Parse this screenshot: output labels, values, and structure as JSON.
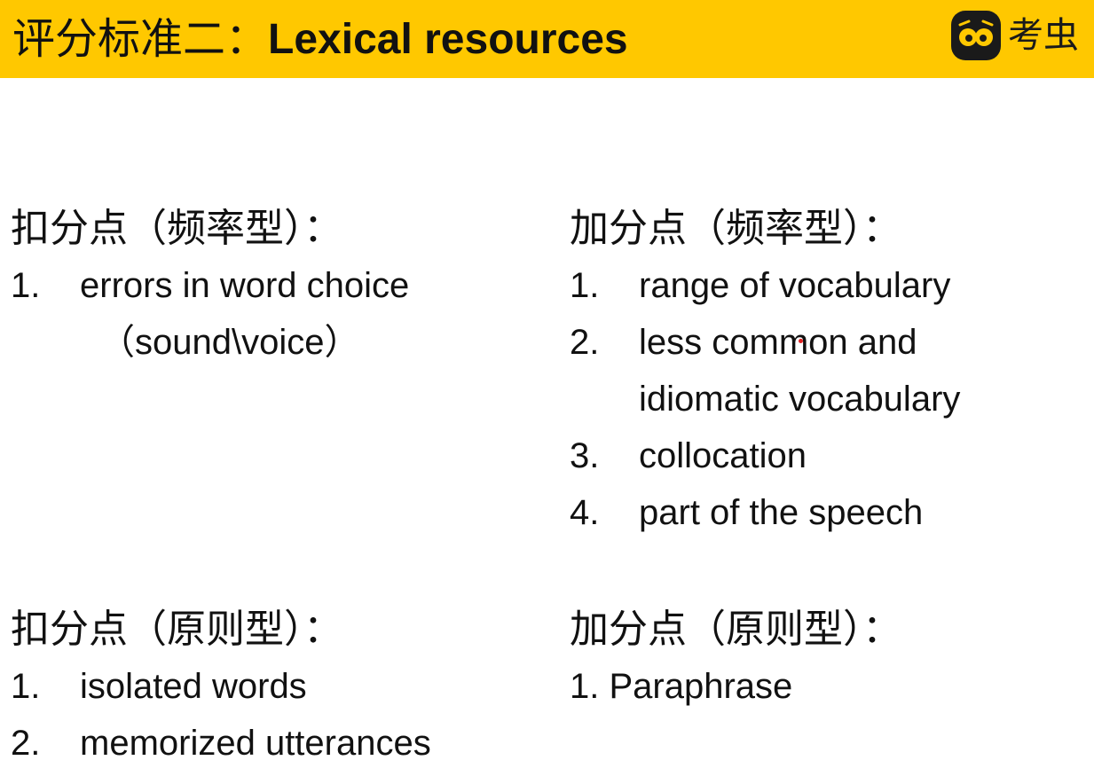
{
  "header": {
    "title_zh": "评分标准二：",
    "title_en": "Lexical resources",
    "logo_text": "考虫",
    "logo_icon": "owl-face-icon",
    "background_color": "#ffc800"
  },
  "deduct_frequency": {
    "heading": "扣分点（频率型）：",
    "items": [
      {
        "num": "1.",
        "text": "errors in word choice",
        "continuation": "（sound\\voice）"
      }
    ]
  },
  "add_frequency": {
    "heading": "加分点（频率型）：",
    "items": [
      {
        "num": "1.",
        "text": "range of vocabulary"
      },
      {
        "num": "2.",
        "text": "less common and",
        "continuation": "idiomatic vocabulary"
      },
      {
        "num": "3.",
        "text": "collocation"
      },
      {
        "num": "4.",
        "text": "part of the speech"
      }
    ]
  },
  "deduct_principle": {
    "heading": "扣分点（原则型）：",
    "items": [
      {
        "num": "1.",
        "text": "isolated words"
      },
      {
        "num": "2.",
        "text": "memorized utterances"
      }
    ]
  },
  "add_principle": {
    "heading": "加分点（原则型）：",
    "items": [
      {
        "text": "1. Paraphrase"
      }
    ]
  }
}
